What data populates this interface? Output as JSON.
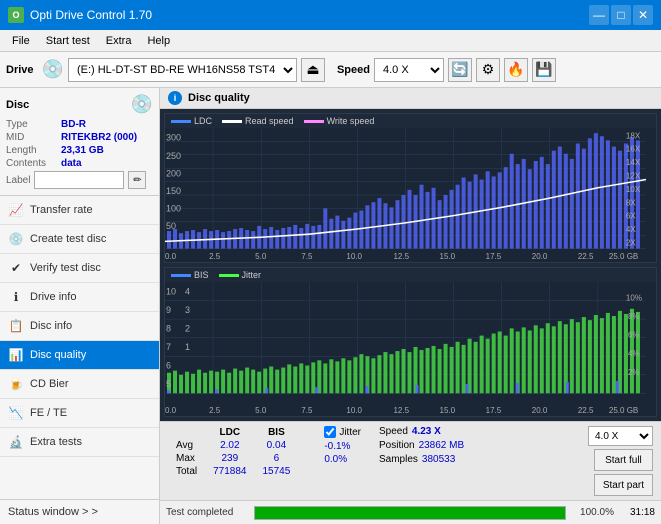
{
  "titleBar": {
    "title": "Opti Drive Control 1.70",
    "minimizeBtn": "—",
    "maximizeBtn": "□",
    "closeBtn": "✕"
  },
  "menuBar": {
    "items": [
      "File",
      "Start test",
      "Extra",
      "Help"
    ]
  },
  "toolbar": {
    "driveLabel": "Drive",
    "driveValue": "(E:)  HL-DT-ST BD-RE  WH16NS58 TST4",
    "speedLabel": "Speed",
    "speedValue": "4.0 X"
  },
  "disc": {
    "title": "Disc",
    "typeLabel": "Type",
    "typeValue": "BD-R",
    "midLabel": "MID",
    "midValue": "RITEKBR2 (000)",
    "lengthLabel": "Length",
    "lengthValue": "23,31 GB",
    "contentsLabel": "Contents",
    "contentsValue": "data",
    "labelLabel": "Label"
  },
  "navItems": [
    {
      "id": "transfer-rate",
      "label": "Transfer rate",
      "icon": "📈"
    },
    {
      "id": "create-test-disc",
      "label": "Create test disc",
      "icon": "💿"
    },
    {
      "id": "verify-test-disc",
      "label": "Verify test disc",
      "icon": "✔"
    },
    {
      "id": "drive-info",
      "label": "Drive info",
      "icon": "ℹ"
    },
    {
      "id": "disc-info",
      "label": "Disc info",
      "icon": "📋"
    },
    {
      "id": "disc-quality",
      "label": "Disc quality",
      "icon": "📊",
      "active": true
    },
    {
      "id": "cd-bier",
      "label": "CD Bier",
      "icon": "🍺"
    },
    {
      "id": "fe-te",
      "label": "FE / TE",
      "icon": "📉"
    },
    {
      "id": "extra-tests",
      "label": "Extra tests",
      "icon": "🔬"
    }
  ],
  "statusWindow": {
    "label": "Status window > >"
  },
  "discQualityHeader": {
    "title": "Disc quality",
    "iconLabel": "i"
  },
  "chart1": {
    "legend": [
      {
        "label": "LDC",
        "color": "#4444ff"
      },
      {
        "label": "Read speed",
        "color": "#ffffff"
      },
      {
        "label": "Write speed",
        "color": "#ff44ff"
      }
    ],
    "yMax": 300,
    "yAxisRight": [
      "18X",
      "16X",
      "14X",
      "12X",
      "10X",
      "8X",
      "6X",
      "4X",
      "2X"
    ],
    "xAxisLabels": [
      "0.0",
      "2.5",
      "5.0",
      "7.5",
      "10.0",
      "12.5",
      "15.0",
      "17.5",
      "20.0",
      "22.5",
      "25.0 GB"
    ]
  },
  "chart2": {
    "legend": [
      {
        "label": "BIS",
        "color": "#4444ff"
      },
      {
        "label": "Jitter",
        "color": "#44ff44"
      }
    ],
    "yMax": 10,
    "yAxisRight": [
      "10%",
      "8%",
      "6%",
      "4%",
      "2%"
    ],
    "xAxisLabels": [
      "0.0",
      "2.5",
      "5.0",
      "7.5",
      "10.0",
      "12.5",
      "15.0",
      "17.5",
      "20.0",
      "22.5",
      "25.0 GB"
    ]
  },
  "stats": {
    "columns": [
      "",
      "LDC",
      "BIS",
      "",
      "Jitter",
      "Speed",
      ""
    ],
    "rows": [
      {
        "label": "Avg",
        "ldc": "2.02",
        "bis": "0.04",
        "jitter": "-0.1%",
        "speed": "4.23 X"
      },
      {
        "label": "Max",
        "ldc": "239",
        "bis": "6",
        "jitter": "0.0%"
      },
      {
        "label": "Total",
        "ldc": "771884",
        "bis": "15745",
        "jitter": ""
      }
    ],
    "jitterChecked": true,
    "speedLabel": "Speed",
    "speedValue": "4.23 X",
    "speedSelectValue": "4.0 X",
    "positionLabel": "Position",
    "positionValue": "23862 MB",
    "samplesLabel": "Samples",
    "samplesValue": "380533",
    "startFullBtn": "Start full",
    "startPartBtn": "Start part"
  },
  "progressBar": {
    "label": "Test completed",
    "percentage": 100,
    "percentText": "100.0%"
  },
  "timeDisplay": "31:18"
}
